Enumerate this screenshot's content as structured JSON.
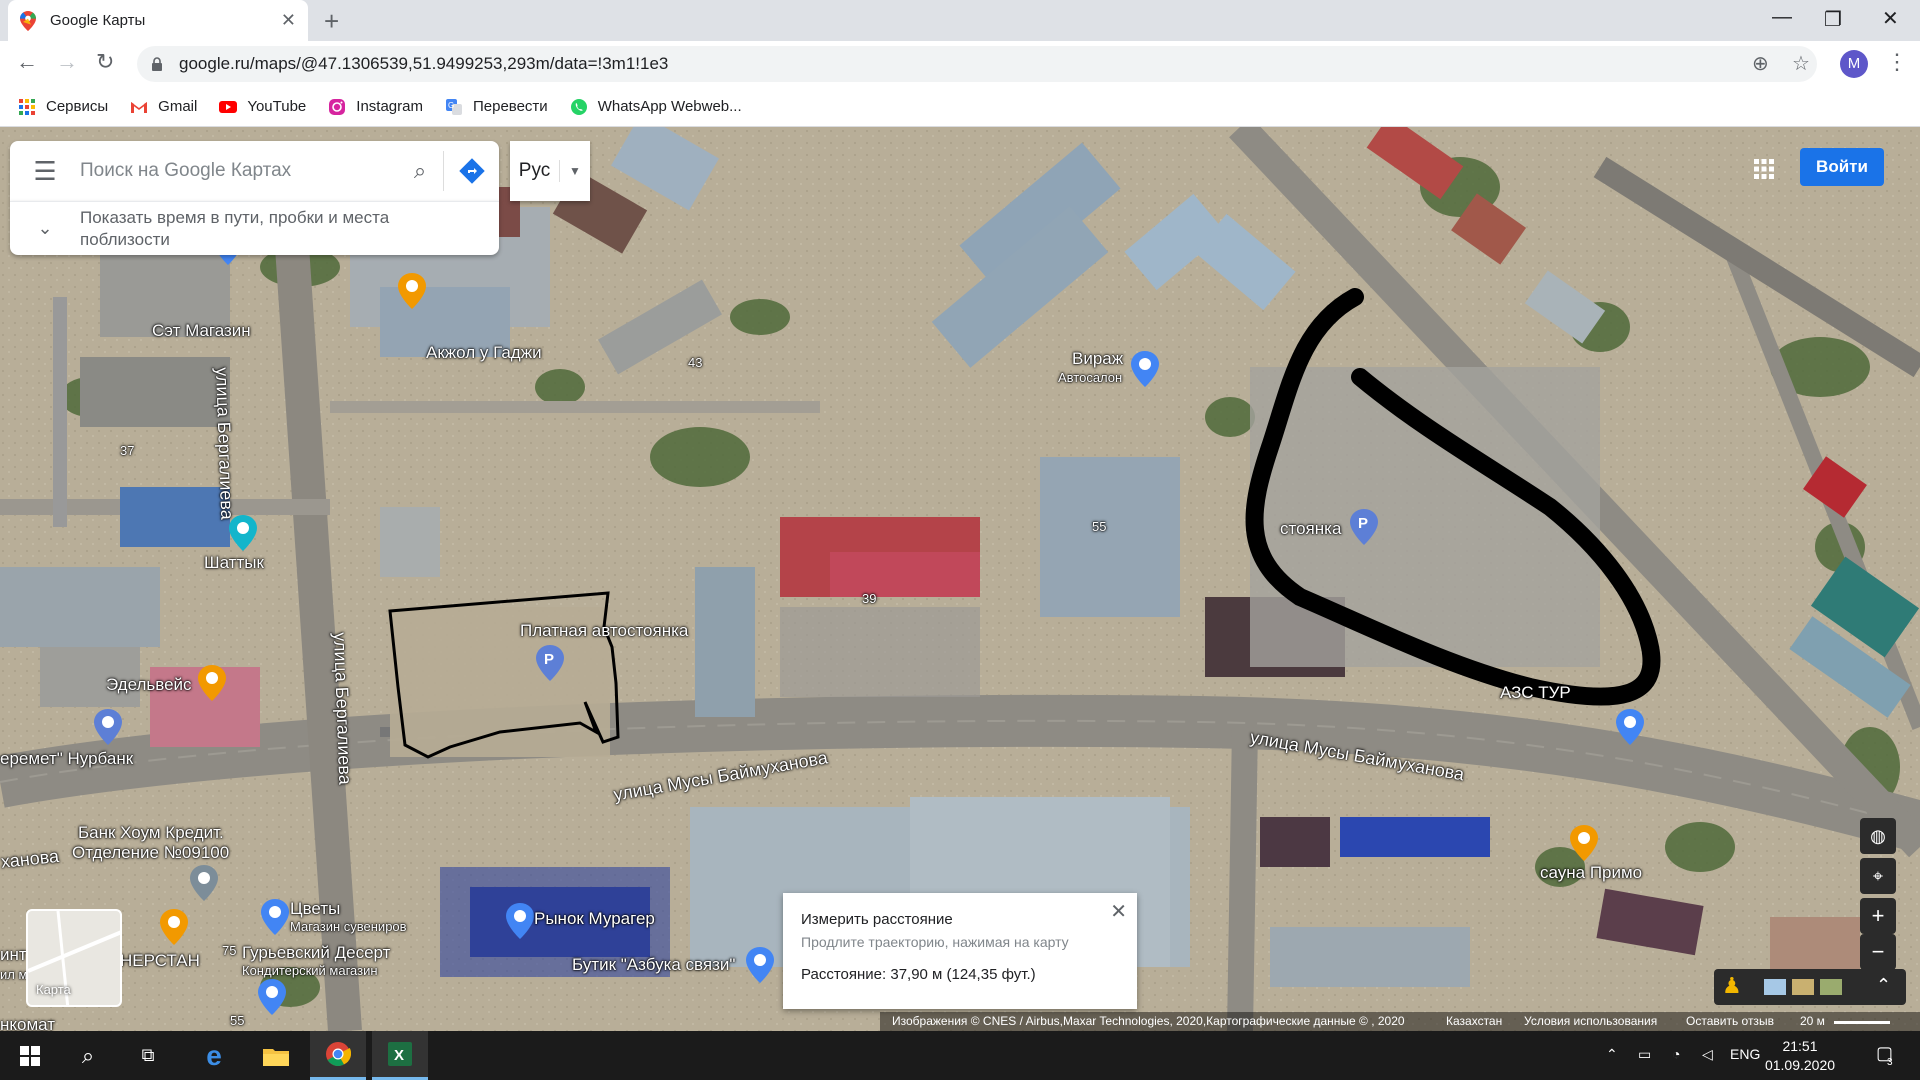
{
  "browser": {
    "tab_title": "Google Карты",
    "url": "google.ru/maps/@47.1306539,51.9499253,293m/data=!3m1!1e3",
    "avatar_letter": "M",
    "bookmarks": [
      "Сервисы",
      "Gmail",
      "YouTube",
      "Instagram",
      "Перевести",
      "WhatsApp Webweb..."
    ]
  },
  "maps": {
    "search_placeholder": "Поиск на Google Картах",
    "subbar_text": "Показать время в пути, пробки и места поблизости",
    "language": "Рус",
    "signin": "Войти",
    "layer_label": "Карта",
    "labels": {
      "set_magazin": "Сэт Магазин",
      "akzhol": "Акжол у Гаджи",
      "virazh": "Вираж",
      "autosalon": "Автосалон",
      "stoyanka": "стоянка",
      "shattyk": "Шаттык",
      "edelweiss": "Эдельвейс",
      "nurbank": "еремет\" Нурбанк",
      "platnaya": "Платная автостоянка",
      "street_bergalieva_1": "улица Бергалиева",
      "street_bergalieva_2": "улица Бергалиева",
      "street_baimukhanova_1": "улица Мусы Баймуханова",
      "street_baimukhanova_2": "улица Мусы Баймуханова",
      "hanova": "ханова",
      "bank_line1": "Банк Хоум Кредит.",
      "bank_line2": "Отделение №09100",
      "tsvety": "Цветы",
      "tsvety_sub": "Магазин сувениров",
      "gurievsky": "Гурьевский Десерт",
      "gurievsky_sub": "Конди­терский магазин",
      "nerstan": "НЕРСТАН",
      "rynok": "Рынок Мурагер",
      "butik": "Бутик \"Азбука связи\"",
      "sauna": "сауна Примо",
      "azs": "АЗС ТУР",
      "int": "инт",
      "il_m": "ил м",
      "nkomat": "нкомат",
      "num_43": "43",
      "num_37": "37",
      "num_55": "55",
      "num_39": "39",
      "num_75": "75",
      "num_55b": "55"
    },
    "measure": {
      "title": "Измерить расстояние",
      "hint": "Продлите траекторию, нажимая на карту",
      "distance": "Расстояние: 37,90 м (124,35 фут.)"
    },
    "attribution": {
      "imagery": "Изображения © CNES / Airbus,Maxar Technologies, 2020,Картографические данные © , 2020",
      "country": "Казахстан",
      "terms": "Условия использования",
      "feedback": "Оставить отзыв",
      "scale": "20 м"
    }
  },
  "taskbar": {
    "lang": "ENG",
    "time": "21:51",
    "date": "01.09.2020",
    "notifications": "3"
  }
}
